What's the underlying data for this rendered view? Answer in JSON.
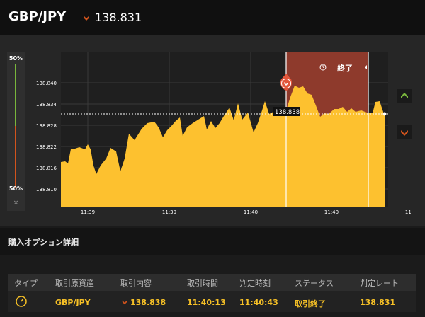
{
  "header": {
    "pair": "GBP/JPY",
    "rate": "138.831",
    "direction_icon": "down-arrow-icon"
  },
  "gauge": {
    "top_label": "50%",
    "bottom_label": "50%",
    "close_label": "×"
  },
  "chart": {
    "y_ticks": [
      "138.840",
      "138.834",
      "138.828",
      "138.822",
      "138.816",
      "138.810"
    ],
    "x_ticks": [
      "11:39",
      "11:39",
      "11:40",
      "11:40",
      "11:41"
    ],
    "entry_label": "138.838",
    "end_label": "終了",
    "colors": {
      "area": "#fdc12f",
      "expiry_zone": "#8e3a2c",
      "up": "#79b63c",
      "down": "#d2541d"
    }
  },
  "section": {
    "title": "購入オプション詳細"
  },
  "table": {
    "headers": [
      "タイプ",
      "取引原資産",
      "取引内容",
      "取引時間",
      "判定時刻",
      "ステータス",
      "判定レート"
    ],
    "row": {
      "asset": "GBP/JPY",
      "content": "138.838",
      "trade_time": "11:40:13",
      "judge_time": "11:40:43",
      "status": "取引終了",
      "rate": "138.831"
    }
  }
}
